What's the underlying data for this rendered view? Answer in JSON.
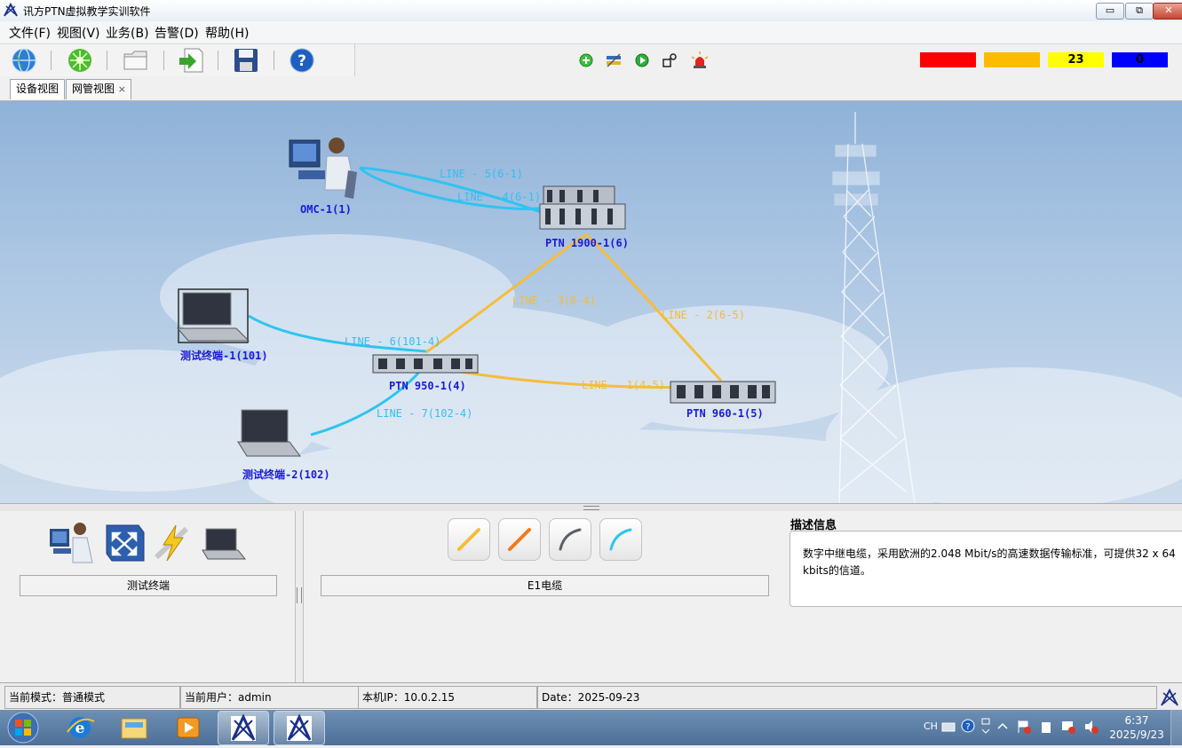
{
  "window": {
    "title": "讯方PTN虚拟教学实训软件",
    "minimize": "▭",
    "restore": "⧉",
    "close": "✕"
  },
  "menu": {
    "items": [
      "文件(F)",
      "视图(V)",
      "业务(B)",
      "告警(D)",
      "帮助(H)"
    ]
  },
  "toolbar": {
    "left_icons": [
      "globe-icon",
      "network-icon",
      "folder-icon",
      "export-icon",
      "save-icon",
      "help-icon"
    ],
    "center_icons": [
      "add-icon",
      "transfer-icon",
      "play-icon",
      "config-icon",
      "alarm-light-icon"
    ],
    "alarms": [
      {
        "color": "#ff0000",
        "value": ""
      },
      {
        "color": "#ffbb00",
        "value": ""
      },
      {
        "color": "#ffff00",
        "value": "23"
      },
      {
        "color": "#0000ff",
        "value": "0"
      }
    ]
  },
  "tabs": [
    {
      "label": "设备视图",
      "active": true
    },
    {
      "label": "网管视图",
      "active": false,
      "close": "×"
    }
  ],
  "topology": {
    "nodes": {
      "omc": "OMC-1(1)",
      "ptn1900": "PTN 1900-1(6)",
      "ptn950": "PTN 950-1(4)",
      "ptn960": "PTN 960-1(5)",
      "term1": "测试终端-1(101)",
      "term2": "测试终端-2(102)"
    },
    "links": {
      "l5": "LINE - 5(6-1)",
      "l4": "LINE - 4(6-1)",
      "l3": "LINE - 3(6-4)",
      "l2": "LINE - 2(6-5)",
      "l1": "LINE - 1(4-5)",
      "l6": "LINE - 6(101-4)",
      "l7": "LINE - 7(102-4)"
    },
    "colors": {
      "fiber": "#2ec4f0",
      "e1": "#f5bd3c"
    }
  },
  "device_panel": {
    "icons": [
      "operator-icon",
      "switch-icon",
      "lightning-icon",
      "laptop-icon"
    ],
    "caption": "测试终端"
  },
  "cable_panel": {
    "icons": [
      "yellow-cable-icon",
      "orange-cable-icon",
      "gray-cable-icon",
      "blue-cable-icon"
    ],
    "caption": "E1电缆"
  },
  "description": {
    "title": "描述信息",
    "text": "数字中继电缆，采用欧洲的2.048 Mbit/s的高速数据传输标准，可提供32 x 64 kbits的信道。"
  },
  "status": {
    "mode": "当前模式：普通模式",
    "user": "当前用户：admin",
    "ip": "本机IP：10.0.2.15",
    "date": "Date：2025-09-23"
  },
  "taskbar": {
    "apps": [
      "start-icon",
      "ie-icon",
      "explorer-icon",
      "media-icon",
      "xunfang-app-icon",
      "xunfang-app-icon"
    ],
    "tray": {
      "lang": "CH",
      "time": "6:37",
      "date": "2025/9/23"
    }
  }
}
